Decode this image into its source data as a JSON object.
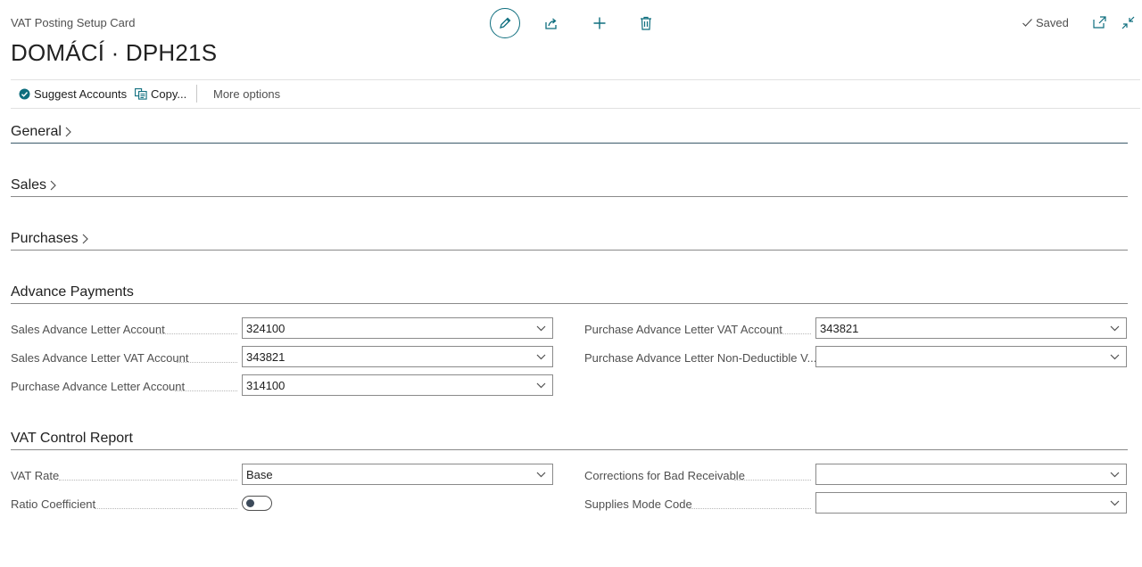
{
  "header": {
    "caption": "VAT Posting Setup Card",
    "title": "DOMÁCÍ · DPH21S",
    "saved_label": "Saved"
  },
  "actionbar": {
    "suggest_label": "Suggest Accounts",
    "copy_label": "Copy...",
    "more_label": "More options"
  },
  "sections": {
    "general": "General",
    "sales": "Sales",
    "purchases": "Purchases",
    "advance": "Advance Payments",
    "vat_control": "VAT Control Report"
  },
  "advance_fields": {
    "sales_adv_letter_account": {
      "label": "Sales Advance Letter Account",
      "value": "324100"
    },
    "sales_adv_letter_vat_account": {
      "label": "Sales Advance Letter VAT Account",
      "value": "343821"
    },
    "purch_adv_letter_account": {
      "label": "Purchase Advance Letter Account",
      "value": "314100"
    },
    "purch_adv_letter_vat_account": {
      "label": "Purchase Advance Letter VAT Account",
      "value": "343821"
    },
    "purch_adv_letter_non_deductible": {
      "label": "Purchase Advance Letter Non-Deductible V...",
      "value": ""
    }
  },
  "vat_control_fields": {
    "vat_rate": {
      "label": "VAT Rate",
      "value": "Base"
    },
    "ratio_coefficient": {
      "label": "Ratio Coefficient",
      "value": false
    },
    "corrections_bad_receivable": {
      "label": "Corrections for Bad Receivable",
      "value": ""
    },
    "supplies_mode_code": {
      "label": "Supplies Mode Code",
      "value": ""
    }
  },
  "colors": {
    "accent": "#0e6e7e",
    "check_badge": "#0e6e7e"
  },
  "icons": [
    "edit-icon",
    "share-icon",
    "plus-icon",
    "trash-icon",
    "check-icon",
    "popout-icon",
    "collapse-icon",
    "suggest-icon",
    "copy-icon",
    "chevron-right-icon",
    "chevron-down-icon"
  ]
}
